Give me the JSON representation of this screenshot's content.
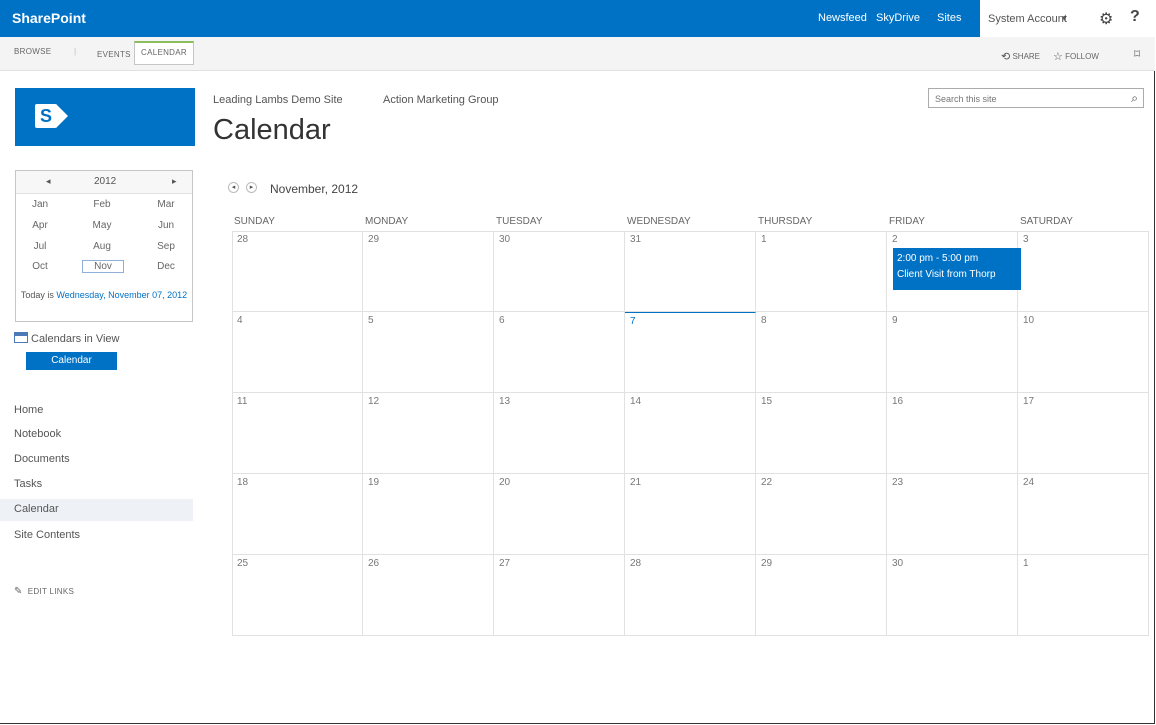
{
  "suite": {
    "brand": "SharePoint",
    "nav": [
      "Newsfeed",
      "SkyDrive",
      "Sites"
    ],
    "account": "System Account",
    "account_caret": "▾",
    "help": "?"
  },
  "ribbon": {
    "tabs": [
      "BROWSE",
      "EVENTS",
      "CALENDAR"
    ],
    "active_tab": "CALENDAR",
    "share": "SHARE",
    "follow": "FOLLOW"
  },
  "site": {
    "logo_letter": "S",
    "breadcrumb": [
      "Leading Lambs Demo Site",
      "Action Marketing Group"
    ],
    "title": "Calendar",
    "search_placeholder": "Search this site"
  },
  "datepicker": {
    "year": "2012",
    "months": [
      "Jan",
      "Feb",
      "Mar",
      "Apr",
      "May",
      "Jun",
      "Jul",
      "Aug",
      "Sep",
      "Oct",
      "Nov",
      "Dec"
    ],
    "selected_month": "Nov",
    "today_prefix": "Today is ",
    "today_link": "Wednesday, November 07, 2012"
  },
  "calendars_in_view": {
    "label": "Calendars in View",
    "chip": "Calendar"
  },
  "left_nav": [
    "Home",
    "Notebook",
    "Documents",
    "Tasks",
    "Calendar",
    "Site Contents"
  ],
  "left_nav_selected": "Calendar",
  "edit_links": "EDIT LINKS",
  "calendar": {
    "month_label": "November, 2012",
    "day_names": [
      "SUNDAY",
      "MONDAY",
      "TUESDAY",
      "WEDNESDAY",
      "THURSDAY",
      "FRIDAY",
      "SATURDAY"
    ],
    "weeks": [
      [
        "28",
        "29",
        "30",
        "31",
        "1",
        "2",
        "3"
      ],
      [
        "4",
        "5",
        "6",
        "7",
        "8",
        "9",
        "10"
      ],
      [
        "11",
        "12",
        "13",
        "14",
        "15",
        "16",
        "17"
      ],
      [
        "18",
        "19",
        "20",
        "21",
        "22",
        "23",
        "24"
      ],
      [
        "25",
        "26",
        "27",
        "28",
        "29",
        "30",
        "1"
      ]
    ],
    "today": "7",
    "event": {
      "time": "2:00 pm - 5:00 pm",
      "title": "Client Visit from Thorp"
    }
  },
  "colors": {
    "suite_blue": "#0072c6",
    "active_tab_accent": "#8cbf5c"
  }
}
